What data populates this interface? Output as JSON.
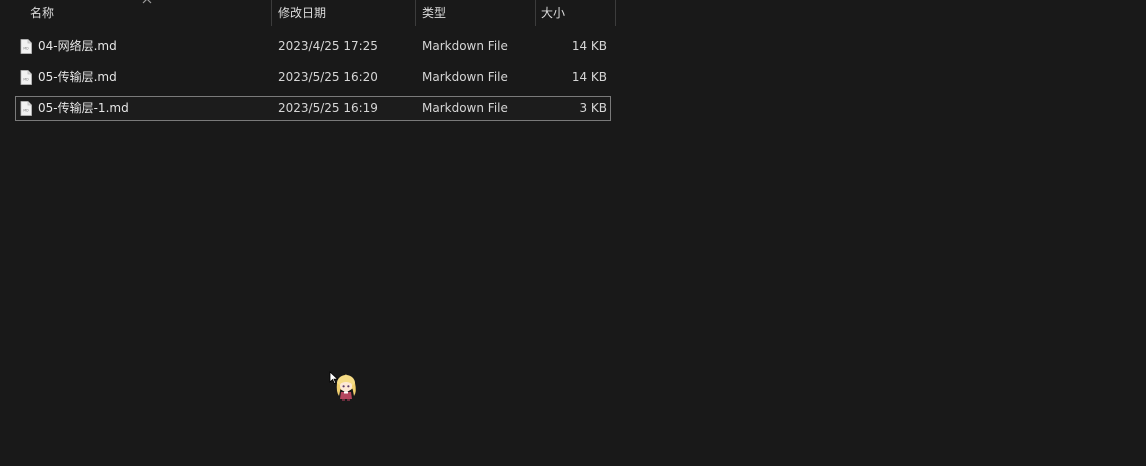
{
  "columns": {
    "name": "名称",
    "date": "修改日期",
    "type": "类型",
    "size": "大小"
  },
  "sort": {
    "column": "name",
    "direction": "ascending",
    "icon": "chevron-up-icon"
  },
  "files": [
    {
      "name": "04-网络层.md",
      "date": "2023/4/25 17:25",
      "type": "Markdown File",
      "size": "14 KB",
      "icon": "markdown-file-icon",
      "selected": false
    },
    {
      "name": "05-传输层.md",
      "date": "2023/5/25 16:20",
      "type": "Markdown File",
      "size": "14 KB",
      "icon": "markdown-file-icon",
      "selected": false
    },
    {
      "name": "05-传输层-1.md",
      "date": "2023/5/25 16:19",
      "type": "Markdown File",
      "size": "3 KB",
      "icon": "markdown-file-icon",
      "selected": true
    }
  ],
  "colors": {
    "background": "#191919",
    "text": "#e6e6e6",
    "selection_border": "#7a7a7a",
    "separator": "#3c3c3c"
  },
  "overlay": {
    "cursor_icon": "mouse-pointer-icon",
    "mascot_icon": "anime-mascot-icon"
  }
}
